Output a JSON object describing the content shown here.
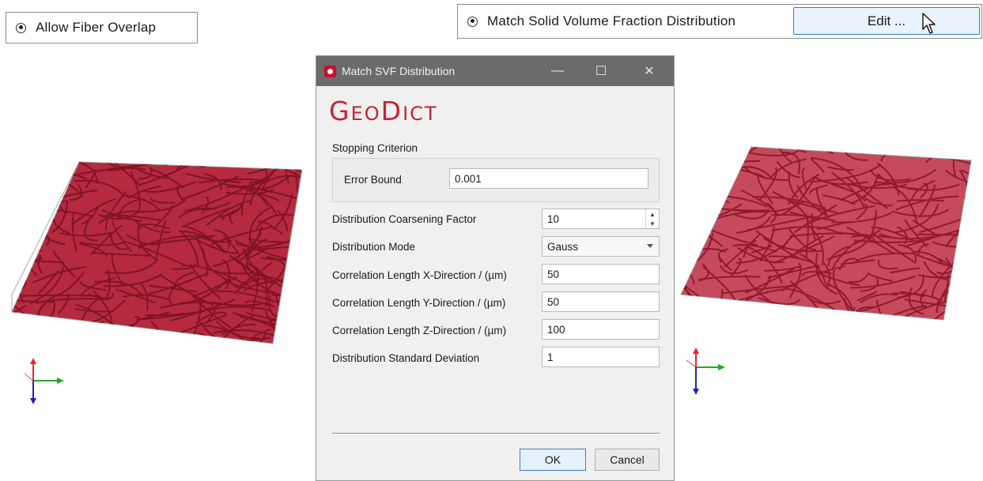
{
  "left_panel": {
    "radio_label": "Allow Fiber Overlap"
  },
  "right_panel": {
    "radio_label": "Match Solid Volume Fraction Distribution",
    "edit_button": "Edit ..."
  },
  "dialog": {
    "title": "Match SVF Distribution",
    "logo": {
      "first": "G",
      "rest1": "EO",
      "mid": "D",
      "rest2": "ICT"
    },
    "stopping_criterion": {
      "title": "Stopping Criterion",
      "error_bound_label": "Error Bound",
      "error_bound_value": "0.001"
    },
    "fields": [
      {
        "label": "Distribution Coarsening Factor",
        "value": "10"
      },
      {
        "label": "Distribution Mode",
        "value": "Gauss"
      },
      {
        "label": "Correlation Length X-Direction / (µm)",
        "value": "50"
      },
      {
        "label": "Correlation Length Y-Direction / (µm)",
        "value": "50"
      },
      {
        "label": "Correlation Length Z-Direction / (µm)",
        "value": "100"
      },
      {
        "label": "Distribution Standard Deviation",
        "value": "1"
      }
    ],
    "ok_label": "OK",
    "cancel_label": "Cancel"
  },
  "colors": {
    "fiber": "#a3172f",
    "brand": "#c8203a",
    "titlebar": "#6b6b6b",
    "accent": "#2f7dd6"
  }
}
